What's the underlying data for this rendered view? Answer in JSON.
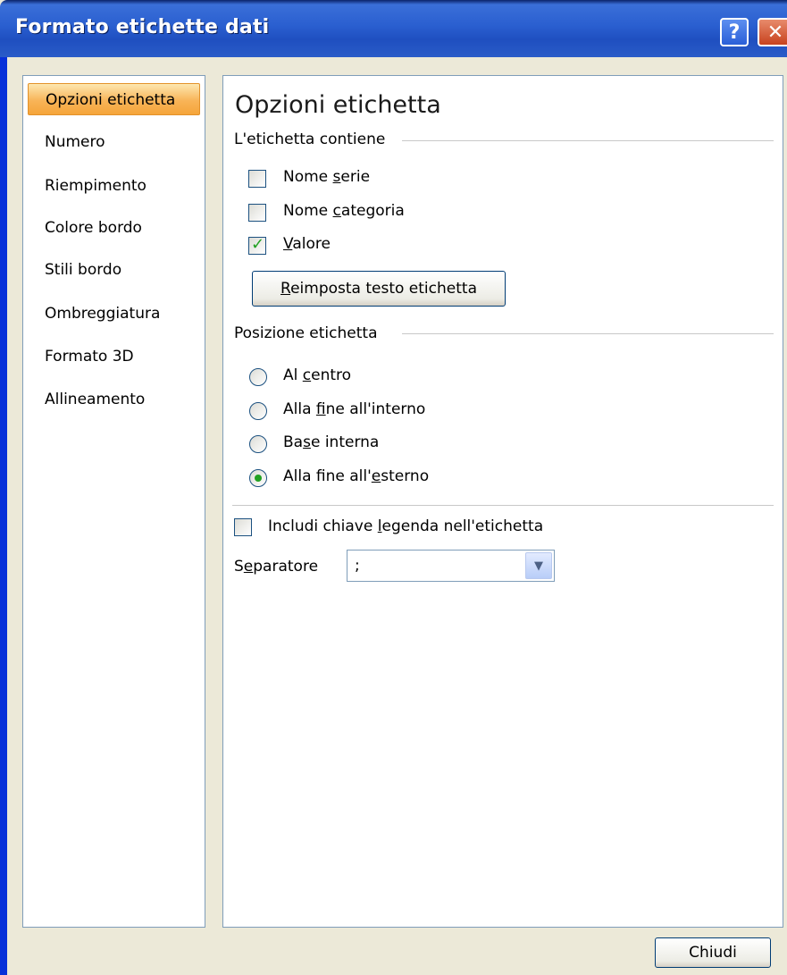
{
  "window": {
    "title": "Formato etichette dati",
    "help_label": "?",
    "close_label": "✕"
  },
  "nav": {
    "items": [
      {
        "label": "Opzioni etichetta",
        "selected": true
      },
      {
        "label": "Numero"
      },
      {
        "label": "Riempimento"
      },
      {
        "label": "Colore bordo"
      },
      {
        "label": "Stili bordo"
      },
      {
        "label": "Ombreggiatura"
      },
      {
        "label": "Formato 3D"
      },
      {
        "label": "Allineamento"
      }
    ]
  },
  "panel": {
    "title": "Opzioni etichetta",
    "contains_group": "L'etichetta contiene",
    "checkboxes": [
      {
        "pre": "Nome ",
        "acc": "s",
        "post": "erie",
        "checked": false
      },
      {
        "pre": "Nome ",
        "acc": "c",
        "post": "ategoria",
        "checked": false
      },
      {
        "pre": "",
        "acc": "V",
        "post": "alore",
        "checked": true
      }
    ],
    "reset_button": {
      "pre": "",
      "acc": "R",
      "post": "eimposta testo etichetta"
    },
    "position_group": "Posizione etichetta",
    "radios": [
      {
        "pre": "Al ",
        "acc": "c",
        "post": "entro",
        "selected": false
      },
      {
        "pre": "Alla ",
        "acc": "f",
        "post": "ine all'interno",
        "selected": false
      },
      {
        "pre": "Ba",
        "acc": "s",
        "post": "e interna",
        "selected": false
      },
      {
        "pre": "Alla fine all'",
        "acc": "e",
        "post": "sterno",
        "selected": true
      }
    ],
    "legend_key": {
      "pre": "Includi chiave ",
      "acc": "l",
      "post": "egenda nell'etichetta",
      "checked": false
    },
    "separator": {
      "pre": "S",
      "acc": "e",
      "post": "paratore",
      "value": ";"
    }
  },
  "footer": {
    "close_button": "Chiudi"
  },
  "colors": {
    "titlebar": "#2a5fd0",
    "selected_nav": "#f8b458",
    "check_tick": "#21a121"
  }
}
